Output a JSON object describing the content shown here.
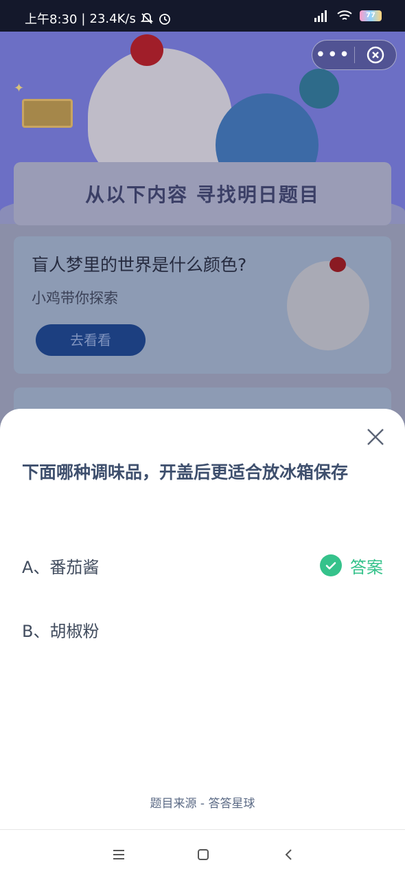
{
  "status_bar": {
    "time": "上午8:30",
    "network_speed": "23.4K/s",
    "battery": "77"
  },
  "background": {
    "banner_title": "从以下内容  寻找明日题目",
    "card_question": "盲人梦里的世界是什么颜色?",
    "card_subtitle": "小鸡带你探索",
    "card_button": "去看看"
  },
  "sheet": {
    "question": "下面哪种调味品，开盖后更适合放冰箱保存",
    "options": [
      {
        "label": "A、番茄酱",
        "is_answer": true
      },
      {
        "label": "B、胡椒粉",
        "is_answer": false
      }
    ],
    "answer_label": "答案",
    "source": "题目来源 - 答答星球"
  },
  "colors": {
    "accent_green": "#35c28b",
    "question_text": "#3e4f6d"
  }
}
